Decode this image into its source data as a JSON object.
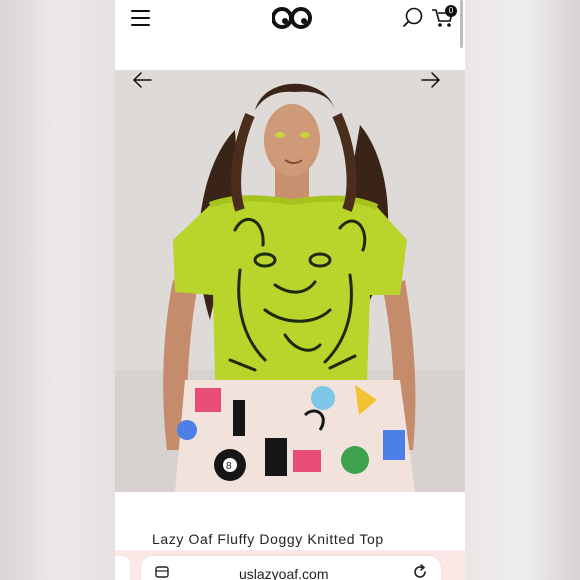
{
  "header": {
    "menu_icon": "hamburger-menu-icon",
    "logo_icon": "lazy-oaf-eyes-logo",
    "search_icon": "search-icon",
    "cart_icon": "cart-icon",
    "cart_count": "0"
  },
  "gallery": {
    "prev_icon": "arrow-left-icon",
    "next_icon": "arrow-right-icon"
  },
  "product": {
    "title": "Lazy Oaf Fluffy Doggy Knitted Top"
  },
  "browser": {
    "url": "uslazyoaf.com",
    "tabs_icon": "tabs-icon",
    "reload_icon": "reload-icon"
  },
  "colors": {
    "sweater": "#b9d42a",
    "accent_bar": "#fde8e8"
  }
}
